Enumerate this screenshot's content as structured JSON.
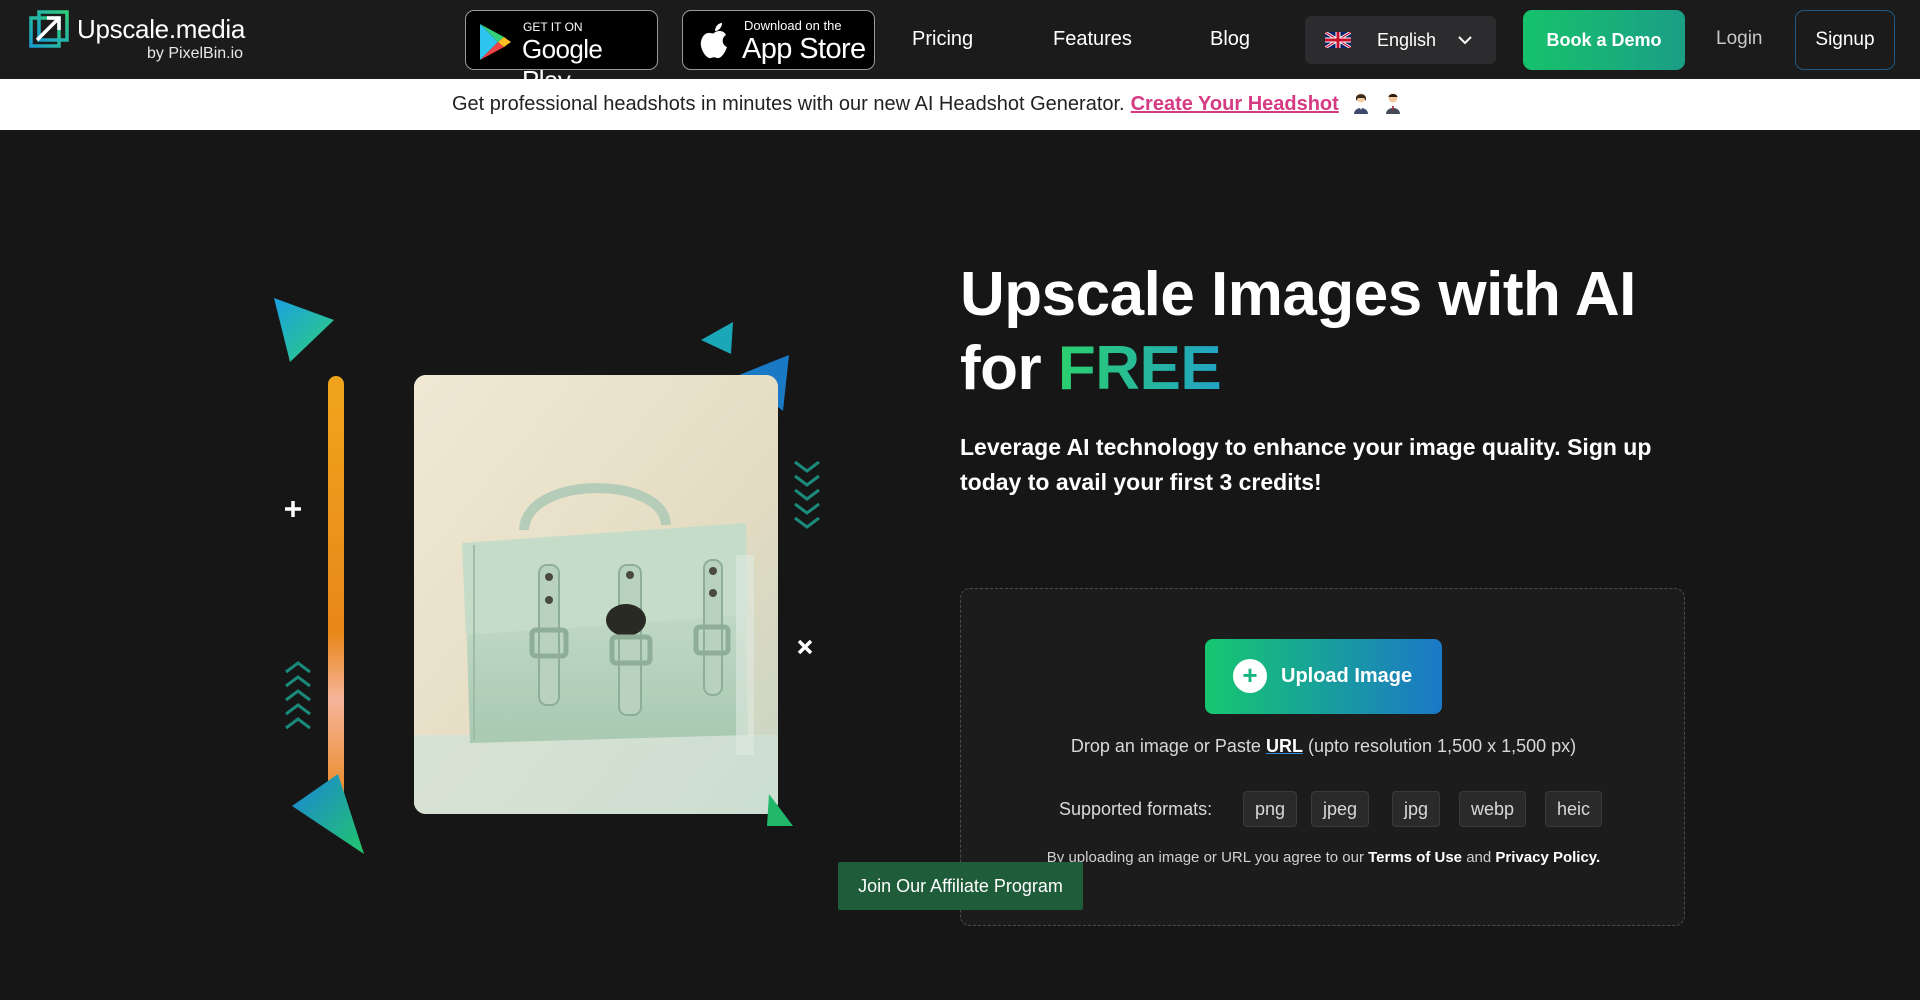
{
  "header": {
    "logo_name": "Upscale.media",
    "logo_sub": "by PixelBin.io",
    "google_play": {
      "small": "GET IT ON",
      "big": "Google Play"
    },
    "app_store": {
      "small": "Download on the",
      "big": "App Store"
    },
    "nav": [
      "Pricing",
      "Features",
      "Blog"
    ],
    "language": "English",
    "book_demo": "Book a Demo",
    "login": "Login",
    "signup": "Signup"
  },
  "banner": {
    "text": "Get professional headshots in minutes with our new AI Headshot Generator.",
    "link": "Create Your Headshot"
  },
  "hero": {
    "title_line1": "Upscale Images with AI",
    "title_for": "for",
    "title_free": "FREE",
    "subtitle": "Leverage AI technology to enhance your image quality. Sign up today to avail your first 3 credits!"
  },
  "upload": {
    "button": "Upload Image",
    "drop_prefix": "Drop an image or Paste",
    "drop_url": "URL",
    "drop_suffix": "(upto resolution 1,500 x 1,500 px)",
    "formats_label": "Supported formats:",
    "formats": [
      "png",
      "jpeg",
      "jpg",
      "webp",
      "heic"
    ],
    "terms_prefix": "By uploading an image or URL you agree to our",
    "terms_link": "Terms of Use",
    "terms_and": "and",
    "privacy_link": "Privacy Policy."
  },
  "affiliate": "Join Our Affiliate Program",
  "colors": {
    "brand_green": "#17c26b",
    "brand_blue": "#1b78c7",
    "banner_link": "#d63a82"
  }
}
